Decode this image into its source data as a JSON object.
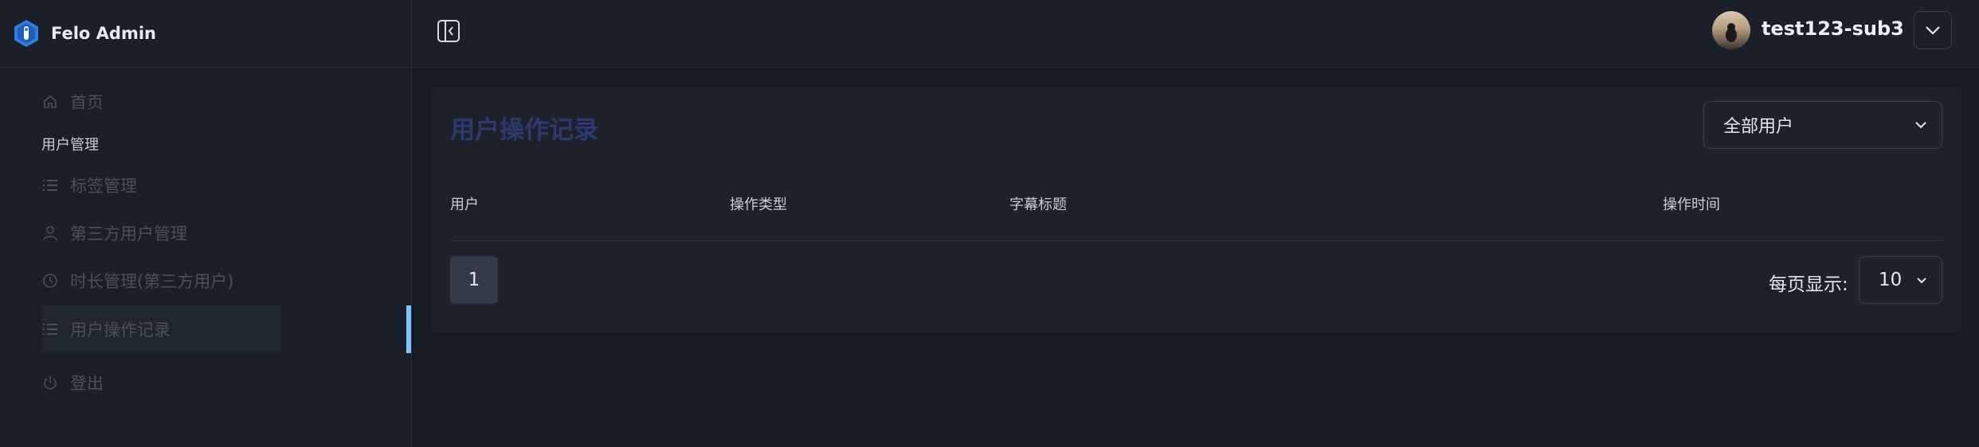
{
  "brand": {
    "name": "Felo Admin"
  },
  "sidebar": {
    "section_label": "用户管理",
    "items": [
      {
        "label": "首页",
        "icon": "home-icon"
      },
      {
        "label": "标签管理",
        "icon": "list-icon"
      },
      {
        "label": "第三方用户管理",
        "icon": "user-icon"
      },
      {
        "label": "时长管理(第三方用户)",
        "icon": "clock-icon"
      },
      {
        "label": "用户操作记录",
        "icon": "list-icon",
        "active": true
      },
      {
        "label": "登出",
        "icon": "power-icon"
      }
    ]
  },
  "header": {
    "user_name": "test123-sub3"
  },
  "main": {
    "title": "用户操作记录",
    "filter_value": "全部用户",
    "columns": [
      "用户",
      "操作类型",
      "字幕标题",
      "操作时间"
    ],
    "rows": [],
    "pagination": {
      "current_page": "1",
      "per_page_label": "每页显示:",
      "per_page_value": "10"
    }
  },
  "colors": {
    "accent": "#7cc6f7",
    "title": "#2e3a6e",
    "background": "#181b23",
    "panel": "#1d212b"
  }
}
